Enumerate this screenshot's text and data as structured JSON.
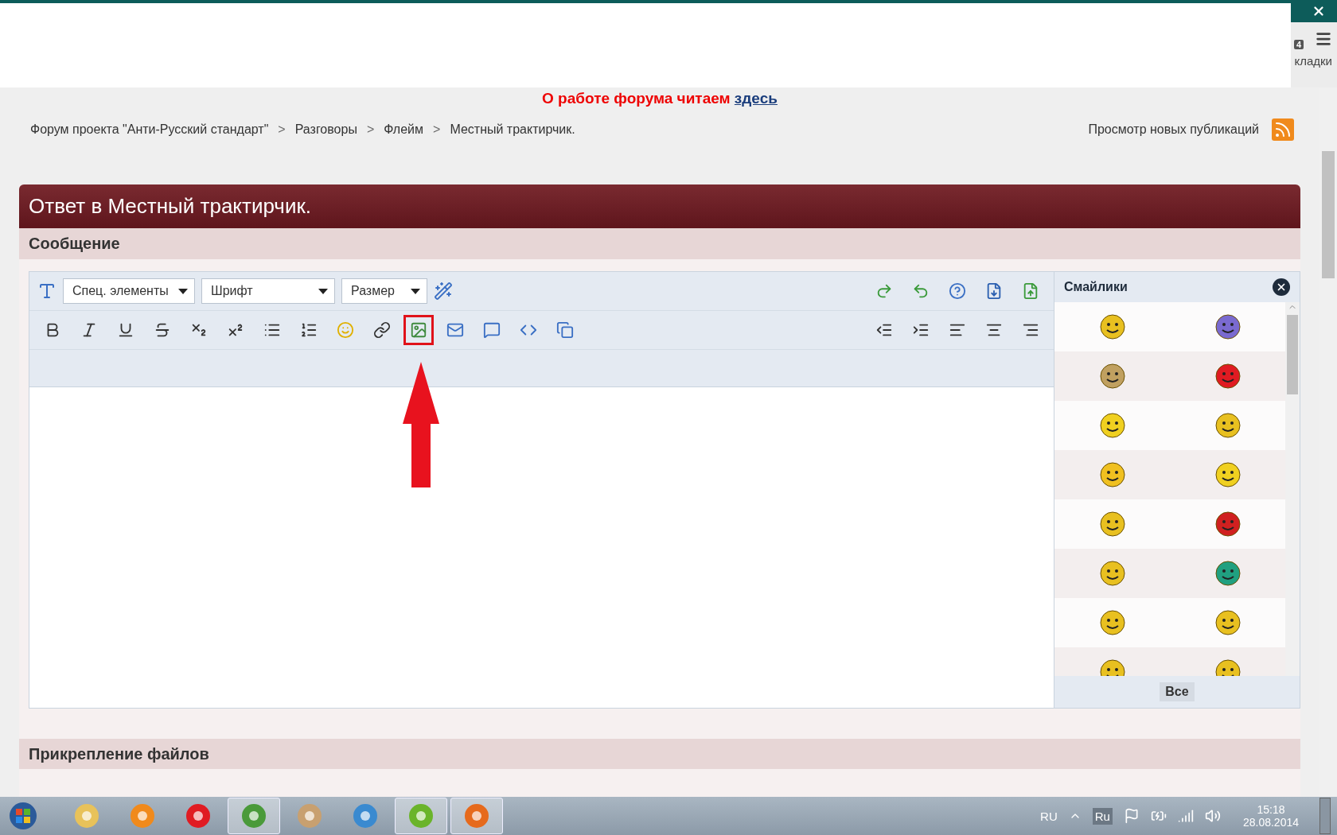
{
  "browser": {
    "tab_fragment": "кладки",
    "badge": "4"
  },
  "notice": {
    "text": "О работе форума читаем",
    "link": "здесь"
  },
  "breadcrumbs": {
    "separator": ">",
    "items": [
      "Форум проекта \"Анти-Русский стандарт\"",
      "Разговоры",
      "Флейм",
      "Местный трактирчик."
    ]
  },
  "new_posts": "Просмотр новых публикаций",
  "reply": {
    "title": "Ответ в Местный трактирчик.",
    "section": "Сообщение"
  },
  "editor": {
    "dropdowns": [
      "Спец. элементы",
      "Шрифт",
      "Размер"
    ],
    "row1_right": [
      {
        "kind": "redo"
      },
      {
        "kind": "undo"
      },
      {
        "kind": "help"
      },
      {
        "kind": "download"
      },
      {
        "kind": "upload"
      }
    ],
    "row2_left": [
      {
        "kind": "bold",
        "highlighted": false
      },
      {
        "kind": "italic",
        "highlighted": false
      },
      {
        "kind": "underline",
        "highlighted": false
      },
      {
        "kind": "strike",
        "highlighted": false
      },
      {
        "kind": "subscript",
        "highlighted": false
      },
      {
        "kind": "superscript",
        "highlighted": false
      },
      {
        "kind": "bullets",
        "highlighted": false
      },
      {
        "kind": "numbers",
        "highlighted": false
      },
      {
        "kind": "smile",
        "highlighted": false
      },
      {
        "kind": "link",
        "highlighted": false
      },
      {
        "kind": "image",
        "highlighted": true
      },
      {
        "kind": "mail",
        "highlighted": false
      },
      {
        "kind": "quote",
        "highlighted": false
      },
      {
        "kind": "code",
        "highlighted": false
      },
      {
        "kind": "copy",
        "highlighted": false
      }
    ],
    "row2_right": [
      {
        "kind": "outdent"
      },
      {
        "kind": "indent"
      },
      {
        "kind": "left"
      },
      {
        "kind": "center"
      },
      {
        "kind": "right"
      }
    ]
  },
  "smilies": {
    "title": "Смайлики",
    "all_button": "Все"
  },
  "attachments": {
    "title": "Прикрепление файлов"
  },
  "taskbar": {
    "apps": [
      {
        "kind": "folder",
        "active": false
      },
      {
        "kind": "player",
        "active": false
      },
      {
        "kind": "yandex",
        "active": false
      },
      {
        "kind": "chrome",
        "active": true
      },
      {
        "kind": "paint",
        "active": false
      },
      {
        "kind": "bird",
        "active": false
      },
      {
        "kind": "torrent",
        "active": true
      },
      {
        "kind": "firefox",
        "active": true
      }
    ],
    "language": "RU",
    "input_language": "Ru",
    "time": "15:18",
    "date": "28.08.2014"
  }
}
